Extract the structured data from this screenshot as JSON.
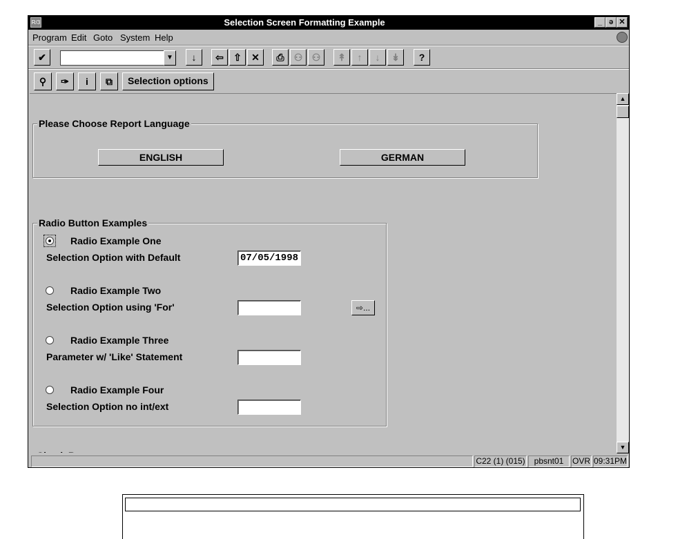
{
  "window": {
    "title": "Selection Screen Formatting Example",
    "sys_icon": "R/3",
    "controls": {
      "minimize": "_",
      "restore": "ə",
      "close": "✕"
    }
  },
  "menu": [
    {
      "label": "Program"
    },
    {
      "label": "Edit"
    },
    {
      "label": "Goto"
    },
    {
      "label": "System"
    },
    {
      "label": "Help"
    }
  ],
  "toolbar": {
    "command_field_value": "",
    "selection_options_label": "Selection options",
    "icons": {
      "enter": "✔",
      "save": "↓",
      "back": "⇦",
      "exit": "⇧",
      "cancel": "✕",
      "print": "⎙",
      "find": "⚇",
      "find_next": "⚇",
      "first_page": "↟",
      "prev_page": "↑",
      "next_page": "↓",
      "last_page": "↡",
      "help": "?",
      "execute": "⚲",
      "variant": "✑",
      "info": "i",
      "copy": "⧉"
    }
  },
  "language_frame": {
    "title": "Please Choose Report Language",
    "english_label": "ENGLISH",
    "german_label": "GERMAN"
  },
  "radio_frame": {
    "title": "Radio Button Examples",
    "rows": [
      {
        "radio_label": "Radio Example One",
        "selected": true,
        "field_label": "Selection Option with Default",
        "value": "07/05/1998"
      },
      {
        "radio_label": "Radio Example Two",
        "selected": false,
        "field_label": "Selection Option using 'For'",
        "value": ""
      },
      {
        "radio_label": "Radio Example Three",
        "selected": false,
        "field_label": "Parameter w/ 'Like' Statement",
        "value": ""
      },
      {
        "radio_label": "Radio Example Four",
        "selected": false,
        "field_label": "Selection Option no int/ext",
        "value": ""
      }
    ],
    "multi_select_icon": "⇨..."
  },
  "cutoff_text": "Check Boxes",
  "status": {
    "system": "C22 (1) (015)",
    "server": "pbsnt01",
    "mode": "OVR",
    "time": "09:31PM"
  }
}
